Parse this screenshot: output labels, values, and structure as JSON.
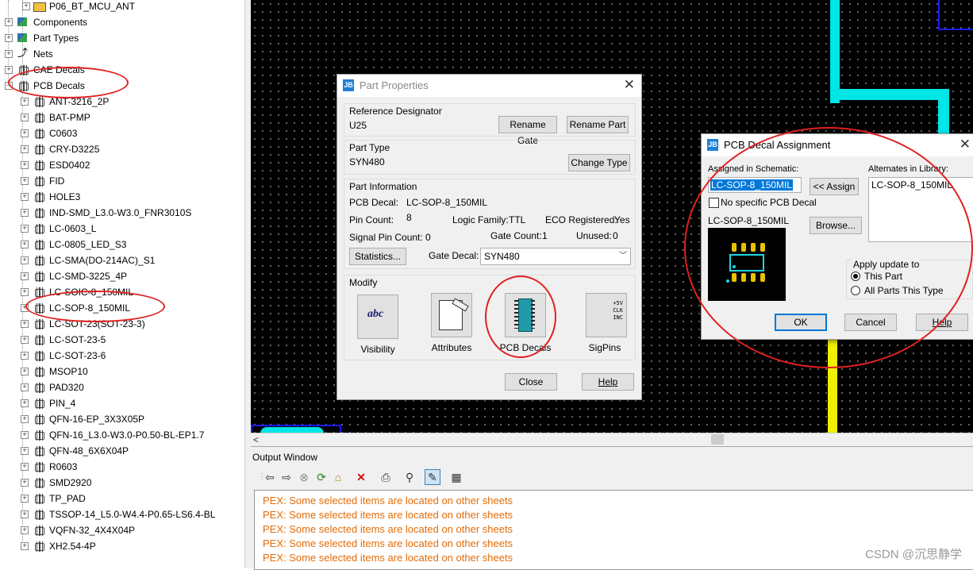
{
  "tree": {
    "top_items": [
      {
        "label": "P06_BT_MCU_ANT",
        "kind": "child"
      },
      {
        "label": "Components",
        "kind": "root"
      },
      {
        "label": "Part Types",
        "kind": "root"
      },
      {
        "label": "Nets",
        "kind": "root"
      },
      {
        "label": "CAE Decals",
        "kind": "root"
      },
      {
        "label": "PCB Decals",
        "kind": "root-open"
      }
    ],
    "decals": [
      "ANT-3216_2P",
      "BAT-PMP",
      "C0603",
      "CRY-D3225",
      "ESD0402",
      "FID",
      "HOLE3",
      "IND-SMD_L3.0-W3.0_FNR3010S",
      "LC-0603_L",
      "LC-0805_LED_S3",
      "LC-SMA(DO-214AC)_S1",
      "LC-SMD-3225_4P",
      "LC-SOIC-8_150MIL",
      "LC-SOP-8_150MIL",
      "LC-SOT-23(SOT-23-3)",
      "LC-SOT-23-5",
      "LC-SOT-23-6",
      "MSOP10",
      "PAD320",
      "PIN_4",
      "QFN-16-EP_3X3X05P",
      "QFN-16_L3.0-W3.0-P0.50-BL-EP1.7",
      "QFN-48_6X6X04P",
      "R0603",
      "SMD2920",
      "TP_PAD",
      "TSSOP-14_L5.0-W4.4-P0.65-LS6.4-BL",
      "VQFN-32_4X4X04P",
      "XH2.54-4P"
    ]
  },
  "part_properties": {
    "title": "Part Properties",
    "refdes_group": "Reference Designator",
    "refdes": "U25",
    "rename_gate": "Rename Gate",
    "rename_part": "Rename Part",
    "parttype_group": "Part Type",
    "parttype": "SYN480",
    "change_type": "Change Type",
    "info_group": "Part Information",
    "pcb_decal_label": "PCB Decal:",
    "pcb_decal_value": "LC-SOP-8_150MIL",
    "pin_count_label": "Pin Count:",
    "pin_count": "8",
    "logic_family_label": "Logic Family:",
    "logic_family": "TTL",
    "eco_label": "ECO Registered:",
    "eco": "Yes",
    "signal_pin_label": "Signal Pin Count:",
    "signal_pin": "0",
    "gate_count_label": "Gate Count:",
    "gate_count": "1",
    "unused_label": "Unused:",
    "unused": "0",
    "statistics": "Statistics...",
    "gate_decal_label": "Gate Decal:",
    "gate_decal": "SYN480",
    "modify_group": "Modify",
    "visibility": "Visibility",
    "attributes": "Attributes",
    "pcb_decals": "PCB Decals",
    "sigpins": "SigPins",
    "close": "Close",
    "help": "Help"
  },
  "decal_assign": {
    "title": "PCB Decal Assignment",
    "assigned_label": "Assigned in Schematic:",
    "assigned_value": "LC-SOP-8_150MIL",
    "assign_btn": "<< Assign",
    "alternates_label": "Alternates in Library:",
    "alternates": [
      "LC-SOP-8_150MIL"
    ],
    "no_specific": "No specific PCB Decal",
    "preview_label": "LC-SOP-8_150MIL",
    "browse": "Browse...",
    "apply_group": "Apply update to",
    "this_part": "This Part",
    "all_parts": "All Parts This Type",
    "ok": "OK",
    "cancel": "Cancel",
    "help": "Help"
  },
  "output": {
    "title": "Output Window",
    "lines": [
      "PEX: Some selected items are located on other sheets",
      "PEX: Some selected items are located on other sheets",
      "PEX: Some selected items are located on other sheets",
      "PEX: Some selected items are located on other sheets",
      "PEX: Some selected items are located on other sheets"
    ],
    "watermark": "CSDN @沉思静学"
  },
  "colors": {
    "highlight": "#e02020",
    "trace_cyan": "#00e5e5",
    "trace_yellow": "#f0f000",
    "message": "#e36c09",
    "pad_yellow": "#e8c200",
    "selection_blue": "#0078d7"
  }
}
